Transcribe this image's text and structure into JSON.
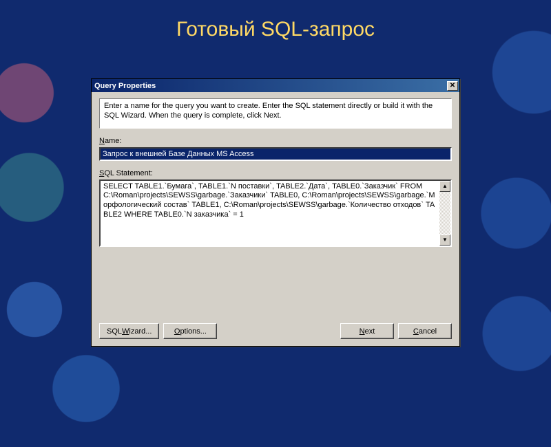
{
  "slide": {
    "title": "Готовый SQL-запрос"
  },
  "dialog": {
    "title": "Query Properties",
    "instructions": "Enter a name for the query you want to create. Enter the SQL statement directly or build it with the SQL Wizard.  When the query is complete, click Next.",
    "name_label_pre": "N",
    "name_label_rest": "ame:",
    "name_value": "Запрос к внешней Базе Данных MS Access",
    "sql_label_pre": "S",
    "sql_label_rest": "QL Statement:",
    "sql_value": "SELECT TABLE1.`Бумага`, TABLE1.`N поставки`, TABLE2.`Дата`, TABLE0.`Заказчик` FROM C:\\Roman\\projects\\SEWSS\\garbage.`Заказчики` TABLE0, C:\\Roman\\projects\\SEWSS\\garbage.`Морфологический состав` TABLE1, C:\\Roman\\projects\\SEWSS\\garbage.`Количество отходов` TABLE2 WHERE TABLE0.`N заказчика` = 1",
    "buttons": {
      "wizard_pre": "SQL ",
      "wizard_ul": "W",
      "wizard_rest": "izard...",
      "options_ul": "O",
      "options_rest": "ptions...",
      "next_ul": "N",
      "next_rest": "ext",
      "cancel_ul": "C",
      "cancel_rest": "ancel"
    }
  }
}
